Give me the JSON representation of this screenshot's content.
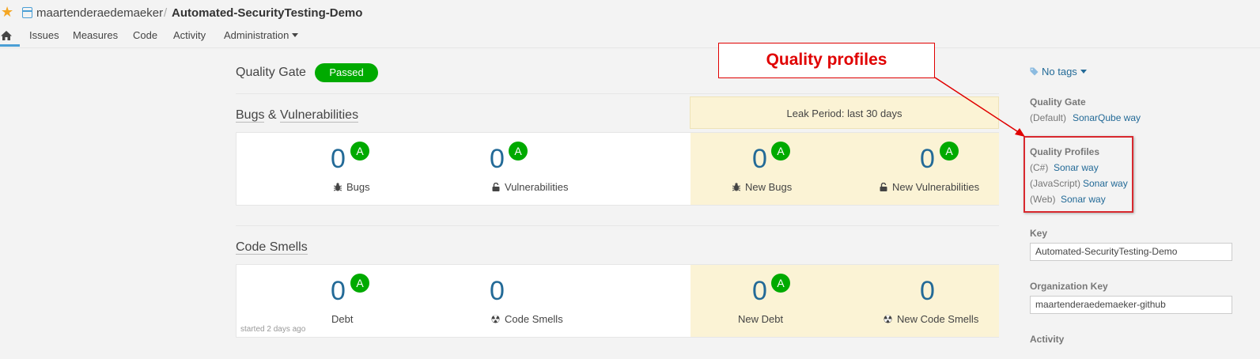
{
  "breadcrumb": {
    "organization": "maartenderaedemaeker",
    "separator": "/",
    "project": "Automated-SecurityTesting-Demo"
  },
  "nav": {
    "items": [
      "Issues",
      "Measures",
      "Code",
      "Activity",
      "Administration"
    ]
  },
  "quality_gate": {
    "title": "Quality Gate",
    "status": "Passed",
    "status_color": "#00aa00"
  },
  "leak_period": "Leak Period: last 30 days",
  "bugs_vulns": {
    "title_part1": "Bugs",
    "title_amp": "&",
    "title_part2": "Vulnerabilities",
    "measures": [
      {
        "value": "0",
        "rating": "A",
        "label": "Bugs",
        "icon": "bug-icon"
      },
      {
        "value": "0",
        "rating": "A",
        "label": "Vulnerabilities",
        "icon": "lock-icon"
      },
      {
        "value": "0",
        "rating": "A",
        "label": "New Bugs",
        "icon": "bug-icon"
      },
      {
        "value": "0",
        "rating": "A",
        "label": "New Vulnerabilities",
        "icon": "lock-icon"
      }
    ]
  },
  "code_smells": {
    "title": "Code Smells",
    "measures": [
      {
        "value": "0",
        "rating": "A",
        "label": "Debt"
      },
      {
        "value": "0",
        "rating": "",
        "label": "Code Smells",
        "icon": "radiation-icon"
      },
      {
        "value": "0",
        "rating": "A",
        "label": "New Debt"
      },
      {
        "value": "0",
        "rating": "",
        "label": "New Code Smells",
        "icon": "radiation-icon"
      }
    ],
    "started": "started 2 days ago"
  },
  "sidebar": {
    "tags": "No tags",
    "quality_gate_label": "Quality Gate",
    "quality_gate_default": "(Default)",
    "quality_gate_link": "SonarQube way",
    "profiles_label": "Quality Profiles",
    "profiles": [
      {
        "lang": "(C#)",
        "name": "Sonar way"
      },
      {
        "lang": "(JavaScript)",
        "name": "Sonar way"
      },
      {
        "lang": "(Web)",
        "name": "Sonar way"
      }
    ],
    "key_label": "Key",
    "key_value": "Automated-SecurityTesting-Demo",
    "org_key_label": "Organization Key",
    "org_key_value": "maartenderaedemaeker-github",
    "activity_label": "Activity"
  },
  "annotation": {
    "text": "Quality profiles",
    "color": "#e00000"
  }
}
